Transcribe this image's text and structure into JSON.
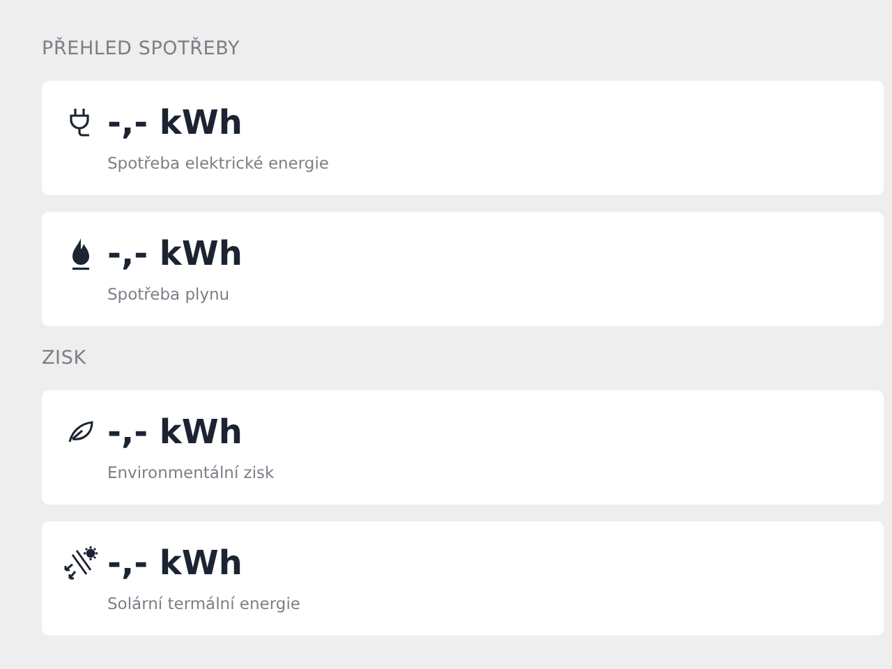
{
  "sections": [
    {
      "title": "PŘEHLED SPOTŘEBY",
      "cards": [
        {
          "kind": "electricity",
          "value": "-,- kWh",
          "label": "Spotřeba elektrické energie"
        },
        {
          "kind": "gas",
          "value": "-,- kWh",
          "label": "Spotřeba plynu"
        }
      ]
    },
    {
      "title": "ZISK",
      "cards": [
        {
          "kind": "environment",
          "value": "-,- kWh",
          "label": "Environmentální zisk"
        },
        {
          "kind": "solar",
          "value": "-,- kWh",
          "label": "Solární termální energie"
        }
      ]
    }
  ]
}
